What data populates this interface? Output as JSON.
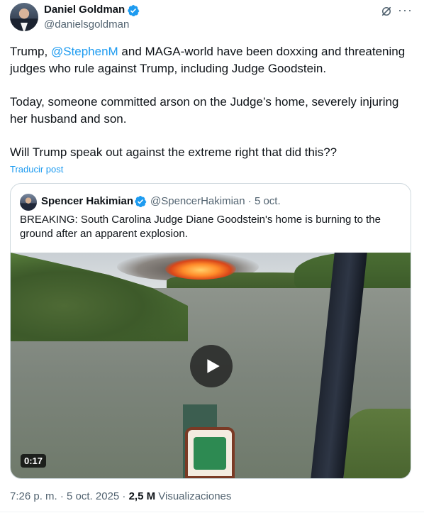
{
  "author": {
    "name": "Daniel Goldman",
    "handle": "@danielsgoldman",
    "verified_icon": "verified-badge-icon"
  },
  "header_actions": {
    "grok_icon": "grok-icon",
    "more_label": "···"
  },
  "post": {
    "line1_prefix": "Trump, ",
    "line1_mention": "@StephenM",
    "line1_suffix": " and MAGA-world have been doxxing and threatening judges who rule against Trump, including Judge Goodstein.",
    "paragraph2": "Today, someone committed arson on the Judge’s home, severely injuring her husband and son.",
    "paragraph3": "Will Trump speak out against the extreme right that did this??",
    "translate_label": "Traducir post"
  },
  "quoted": {
    "name": "Spencer Hakimian",
    "handle_and_time": "@SpencerHakimian · 5 oct.",
    "text": "BREAKING: South Carolina Judge Diane Goodstein's home is burning to the ground after an apparent explosion.",
    "video_duration": "0:17",
    "play_icon": "play-icon"
  },
  "footer": {
    "time_date": "7:26 p. m. · 5 oct. 2025 · ",
    "views_count": "2,5 M",
    "views_label": " Visualizaciones"
  },
  "colors": {
    "accent": "#1d9bf0",
    "text": "#0f1419",
    "muted": "#536471",
    "border": "#cfd9de"
  }
}
